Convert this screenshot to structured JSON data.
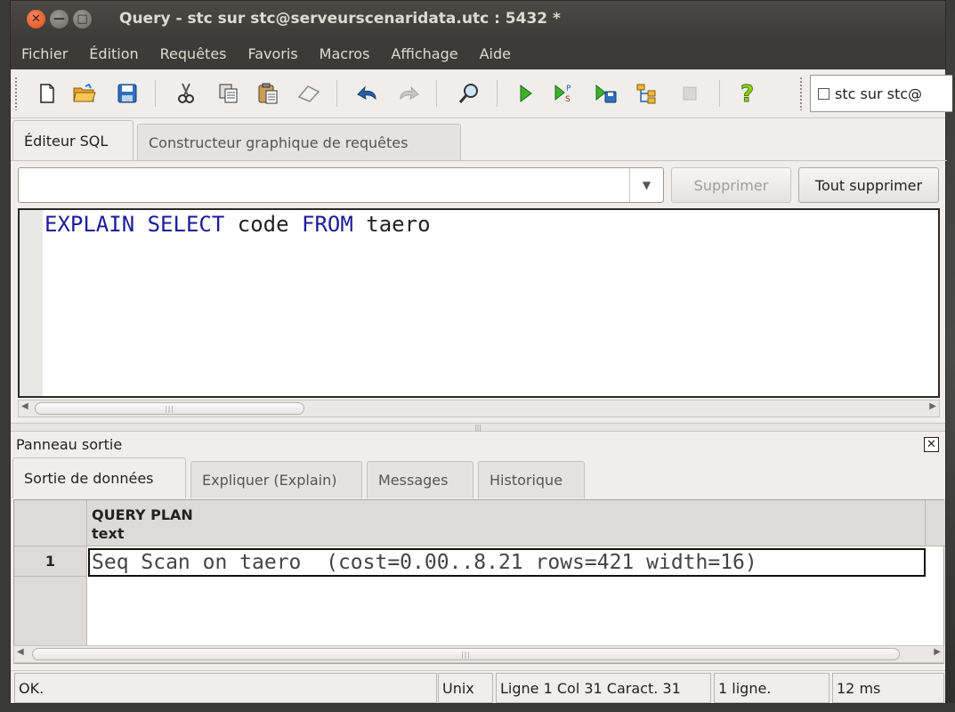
{
  "window": {
    "title": "Query - stc sur stc@serveurscenaridata.utc : 5432 *",
    "close_glyph": "✕",
    "minimize_glyph": "—",
    "maximize_glyph": "□"
  },
  "menubar": {
    "items": [
      "Fichier",
      "Édition",
      "Requêtes",
      "Favoris",
      "Macros",
      "Affichage",
      "Aide"
    ]
  },
  "toolbar": {
    "icons": [
      "new-file-icon",
      "open-folder-icon",
      "save-icon",
      "cut-icon",
      "copy-icon",
      "paste-icon",
      "clear-icon",
      "undo-icon",
      "redo-icon",
      "find-icon",
      "execute-icon",
      "execute-pgscript-icon",
      "execute-to-file-icon",
      "explain-icon",
      "cancel-icon",
      "help-icon"
    ],
    "connection_label": "stc sur stc@"
  },
  "editor_tabs": [
    {
      "label": "Éditeur SQL",
      "active": true
    },
    {
      "label": "Constructeur graphique de requêtes",
      "active": false
    }
  ],
  "editor": {
    "history_value": "",
    "delete_label": "Supprimer",
    "delete_all_label": "Tout supprimer",
    "sql": {
      "kw1": "EXPLAIN",
      "kw2": "SELECT",
      "t1": "code",
      "kw3": "FROM",
      "t2": "taero"
    }
  },
  "output": {
    "panel_title": "Panneau sortie",
    "tabs": [
      {
        "label": "Sortie de données",
        "active": true
      },
      {
        "label": "Expliquer (Explain)",
        "active": false
      },
      {
        "label": "Messages",
        "active": false
      },
      {
        "label": "Historique",
        "active": false
      }
    ],
    "grid": {
      "column_name": "QUERY PLAN",
      "column_type": "text",
      "rows": [
        {
          "num": "1",
          "value": "Seq Scan on taero  (cost=0.00..8.21 rows=421 width=16)"
        }
      ]
    }
  },
  "status": {
    "message": "OK.",
    "line_ending": "Unix",
    "position": "Ligne 1 Col 31 Caract. 31",
    "rows": "1 ligne.",
    "duration": "12 ms"
  },
  "colors": {
    "titlebar": "#3c3b37",
    "sql_keyword": "#1c1c9a",
    "window_bg": "#efeeec"
  }
}
